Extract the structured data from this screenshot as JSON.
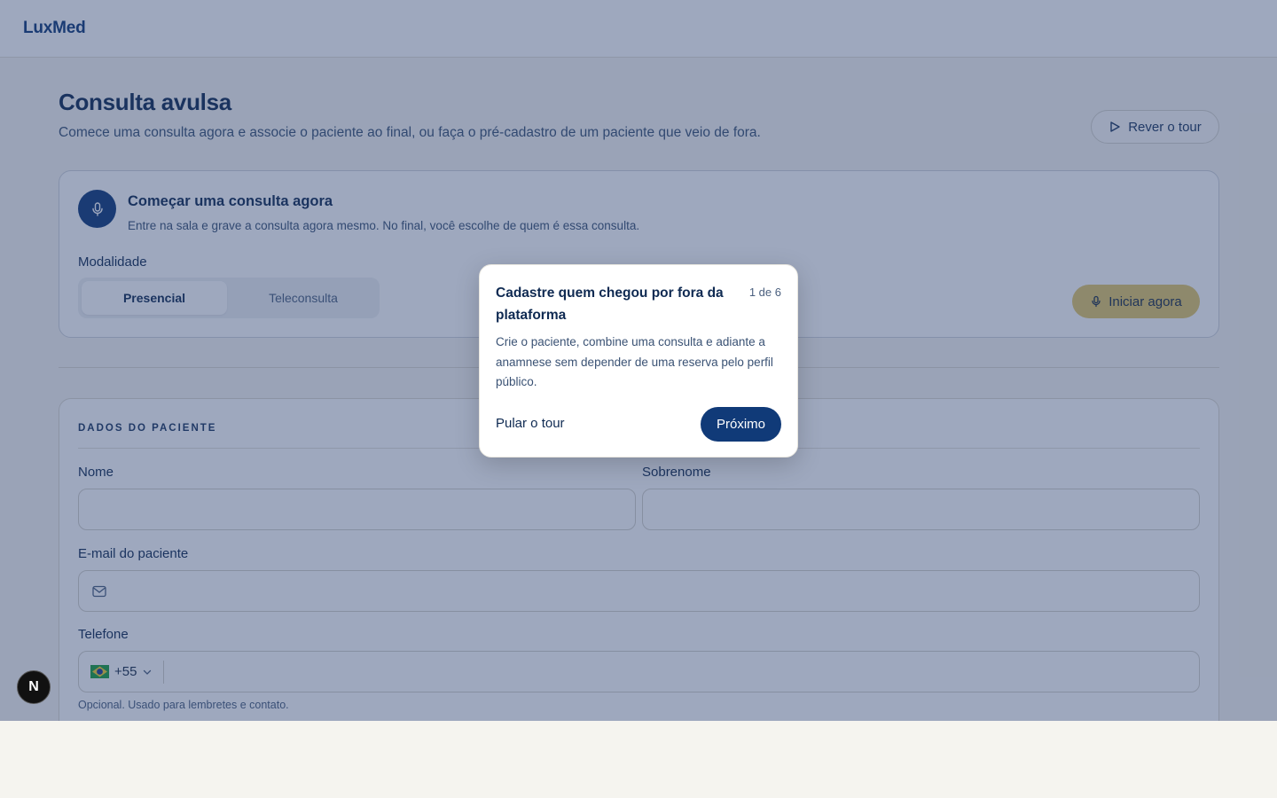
{
  "header": {
    "brand": "LuxMed"
  },
  "page": {
    "title": "Consulta avulsa",
    "subtitle": "Comece uma consulta agora e associe o paciente ao final, ou faça o pré-cadastro de um paciente que veio de fora.",
    "tour_button": "Rever o tour"
  },
  "start_card": {
    "title": "Começar uma consulta agora",
    "description": "Entre na sala e grave a consulta agora mesmo. No final, você escolhe de quem é essa consulta.",
    "modality_label": "Modalidade",
    "modalities": [
      "Presencial",
      "Teleconsulta"
    ],
    "selected_modality": "Presencial",
    "start_button": "Iniciar agora"
  },
  "patient": {
    "section_label": "DADOS DO PACIENTE",
    "first_name_label": "Nome",
    "last_name_label": "Sobrenome",
    "email_label": "E-mail do paciente",
    "phone_label": "Telefone",
    "country_code": "+55",
    "phone_helper": "Opcional. Usado para lembretes e contato."
  },
  "tour": {
    "title": "Cadastre quem chegou por fora da plataforma",
    "step": "1 de 6",
    "body": "Crie o paciente, combine uma consulta e adiante a anamnese sem depender de uma reserva pelo perfil público.",
    "skip": "Pular o tour",
    "next": "Próximo"
  },
  "dev_badge": "N",
  "colors": {
    "primary": "#103a78",
    "accent": "#e2c76a",
    "overlay": "#283e6e"
  }
}
